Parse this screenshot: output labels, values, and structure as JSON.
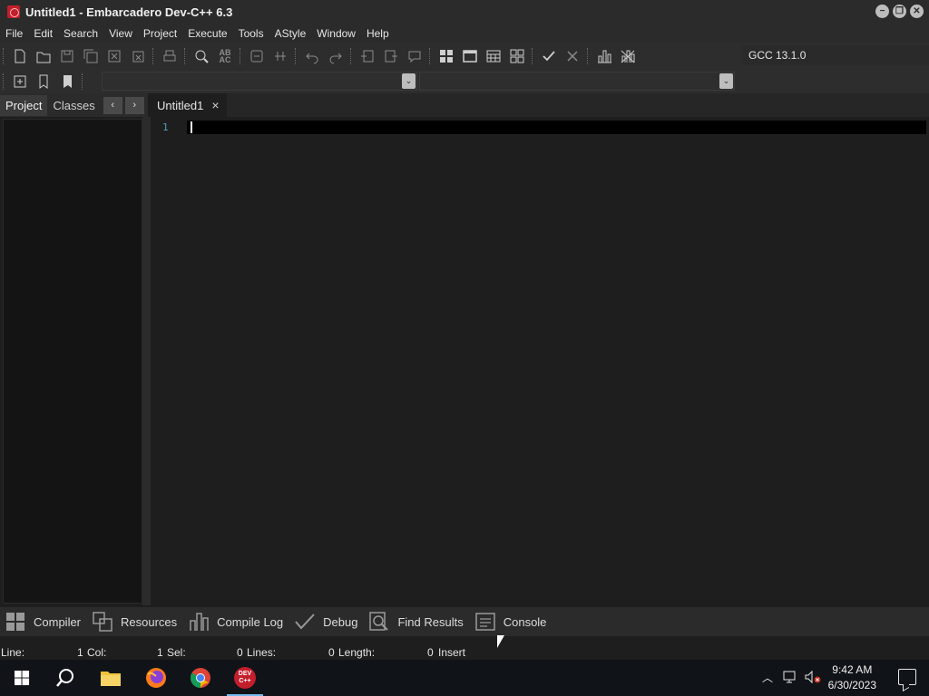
{
  "window": {
    "title": "Untitled1 - Embarcadero Dev-C++ 6.3"
  },
  "menu": [
    "File",
    "Edit",
    "Search",
    "View",
    "Project",
    "Execute",
    "Tools",
    "AStyle",
    "Window",
    "Help"
  ],
  "toolbar": {
    "compiler": "GCC 13.1.0",
    "icons": [
      "new-file-icon",
      "open-file-icon",
      "save-icon",
      "save-all-icon",
      "close-icon",
      "close-all-icon",
      "print-icon",
      "find-icon",
      "replace-icon",
      "find-next-icon",
      "goto-line-icon",
      "undo-icon",
      "redo-icon",
      "indent-icon",
      "unindent-icon",
      "comment-icon",
      "compile-icon",
      "run-icon",
      "compile-run-icon",
      "rebuild-icon",
      "syntax-check-icon",
      "stop-icon",
      "profile-icon",
      "delete-profile-icon"
    ]
  },
  "left_panel": {
    "tabs": [
      "Project",
      "Classes"
    ],
    "active_tab": "Project"
  },
  "editor": {
    "tabs": [
      {
        "label": "Untitled1",
        "close": "×"
      }
    ],
    "line_numbers": [
      "1"
    ]
  },
  "bottom_tabs": [
    "Compiler",
    "Resources",
    "Compile Log",
    "Debug",
    "Find Results",
    "Console"
  ],
  "status": {
    "line_label": "Line:",
    "line_value": "1",
    "col_label": "Col:",
    "col_value": "1",
    "sel_label": "Sel:",
    "sel_value": "0",
    "lines_label": "Lines:",
    "lines_value": "0",
    "length_label": "Length:",
    "length_value": "0",
    "mode": "Insert"
  },
  "taskbar": {
    "time": "9:42 AM",
    "date": "6/30/2023",
    "apps": [
      "start-icon",
      "search-icon",
      "file-explorer-icon",
      "firefox-icon",
      "chrome-icon",
      "devcpp-icon"
    ],
    "devcpp_label": "DEV C++"
  }
}
